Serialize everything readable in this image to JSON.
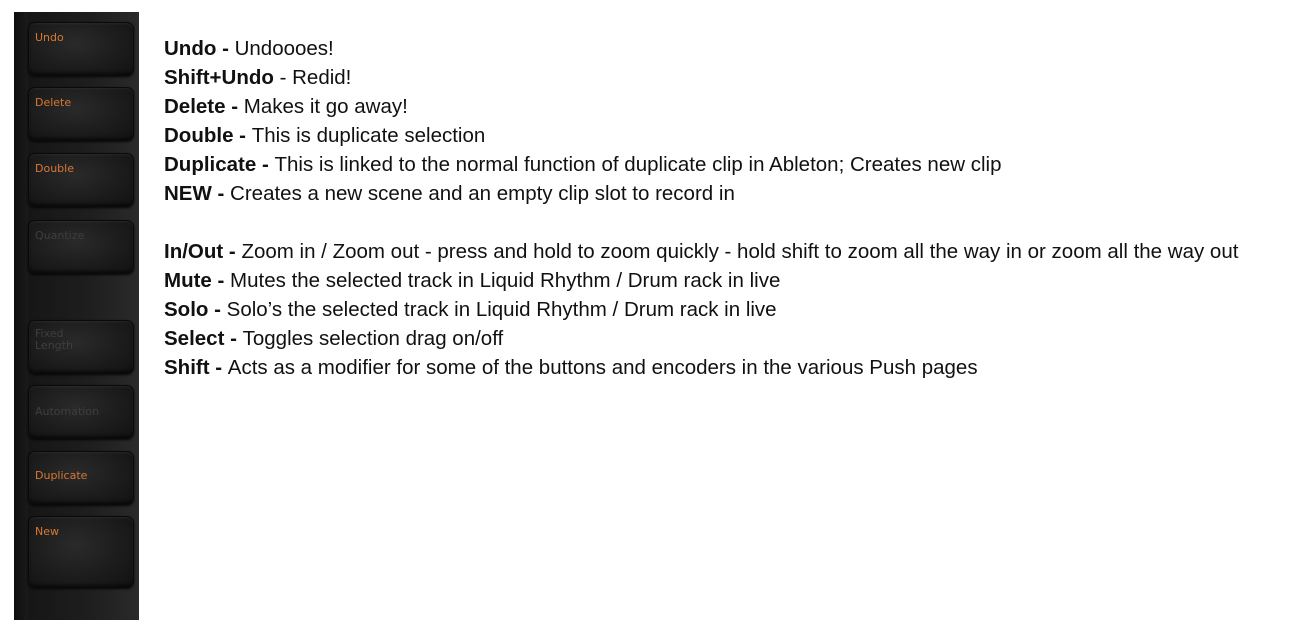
{
  "pads": [
    {
      "label": "Undo",
      "lit": true
    },
    {
      "label": "Delete",
      "lit": true
    },
    {
      "label": "Double",
      "lit": true
    },
    {
      "label": "Quantize",
      "lit": false
    },
    {
      "label": "Fixed\nLength",
      "lit": false
    },
    {
      "label": "Automation",
      "lit": false
    },
    {
      "label": "Duplicate",
      "lit": true
    },
    {
      "label": "New",
      "lit": true
    }
  ],
  "entries": [
    {
      "key": "Undo - ",
      "desc": "Undoooes!"
    },
    {
      "key": "Shift+Undo",
      "desc": " - Redid!"
    },
    {
      "key": "Delete - ",
      "desc": "Makes it go away!"
    },
    {
      "key": "Double - ",
      "desc": "This is duplicate selection"
    },
    {
      "key": "Duplicate - ",
      "desc": "This is linked to the normal function of duplicate clip in Ableton;  Creates new clip"
    },
    {
      "key": "NEW - ",
      "desc": "Creates a new scene and an empty clip slot to record in"
    },
    {
      "key": "In/Out - ",
      "desc": "Zoom in / Zoom out - press and hold to zoom quickly - hold shift to zoom all the way in or zoom all the way out"
    },
    {
      "key": "Mute - ",
      "desc": "Mutes the selected track in Liquid Rhythm / Drum rack in live"
    },
    {
      "key": "Solo - ",
      "desc": "Solo’s the selected track in Liquid Rhythm / Drum rack in live"
    },
    {
      "key": "Select - ",
      "desc": "Toggles selection drag on/off"
    },
    {
      "key": "Shift - ",
      "desc": "Acts as a modifier for some of the buttons and encoders in the various Push pages"
    }
  ]
}
